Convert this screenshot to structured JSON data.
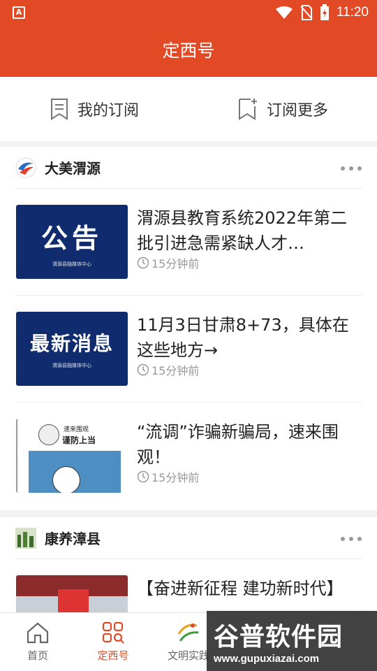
{
  "statusbar": {
    "app_icon": "A",
    "time": "11:20",
    "icons": [
      "wifi-icon",
      "no-sim-icon",
      "battery-charging-icon"
    ]
  },
  "header": {
    "title": "定西号"
  },
  "subscribe": {
    "my_label": "我的订阅",
    "more_label": "订阅更多"
  },
  "sections": [
    {
      "name": "大美渭源",
      "items": [
        {
          "title": "渭源县教育系统2022年第二批引进急需紧缺人才…",
          "time": "15分钟前",
          "thumb_text": "公告",
          "thumb_caption": "渭源县融媒体中心"
        },
        {
          "title": "11月3日甘肃8+73，具体在这些地方→",
          "time": "15分钟前",
          "thumb_text": "最新消息",
          "thumb_caption": "渭源县融媒体中心"
        },
        {
          "title": "“流调”诈骗新骗局，速来围观！",
          "time": "15分钟前",
          "thumb_text": "谨防上当",
          "thumb_caption": "速来围观"
        }
      ]
    },
    {
      "name": "康养漳县",
      "items": [
        {
          "title": "【奋进新征程 建功新时代】",
          "time": ""
        }
      ]
    }
  ],
  "tabs": [
    {
      "label": "首页",
      "icon": "home-icon",
      "active": false
    },
    {
      "label": "定西号",
      "icon": "grid-search-icon",
      "active": true
    },
    {
      "label": "文明实践",
      "icon": "wenming-logo-icon",
      "active": false
    }
  ],
  "watermark": {
    "brand": "谷普软件园",
    "url": "www.gupuxiazai.com"
  },
  "colors": {
    "brand": "#e24a25",
    "thumb_blue": "#112c6e",
    "text": "#222222",
    "meta": "#999999"
  }
}
